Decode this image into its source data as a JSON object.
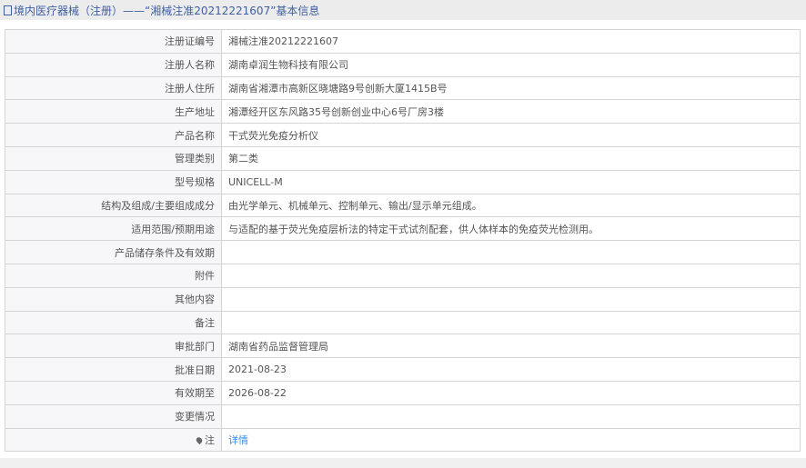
{
  "title": "境内医疗器械（注册）——“湘械注准20212221607”基本信息",
  "rows": [
    {
      "label": "注册证编号",
      "value": "湘械注准20212221607"
    },
    {
      "label": "注册人名称",
      "value": "湖南卓润生物科技有限公司"
    },
    {
      "label": "注册人住所",
      "value": "湖南省湘潭市高新区晓塘路9号创新大厦1415B号"
    },
    {
      "label": "生产地址",
      "value": "湘潭经开区东风路35号创新创业中心6号厂房3楼"
    },
    {
      "label": "产品名称",
      "value": "干式荧光免疫分析仪"
    },
    {
      "label": "管理类别",
      "value": "第二类"
    },
    {
      "label": "型号规格",
      "value": "UNICELL-M"
    },
    {
      "label": "结构及组成/主要组成成分",
      "value": "由光学单元、机械单元、控制单元、输出/显示单元组成。"
    },
    {
      "label": "适用范围/预期用途",
      "value": "与适配的基于荧光免疫层析法的特定干式试剂配套，供人体样本的免疫荧光检测用。"
    },
    {
      "label": "产品储存条件及有效期",
      "value": ""
    },
    {
      "label": "附件",
      "value": ""
    },
    {
      "label": "其他内容",
      "value": ""
    },
    {
      "label": "备注",
      "value": ""
    },
    {
      "label": "审批部门",
      "value": "湖南省药品监督管理局"
    },
    {
      "label": "批准日期",
      "value": "2021-08-23"
    },
    {
      "label": "有效期至",
      "value": "2026-08-22"
    },
    {
      "label": "变更情况",
      "value": ""
    }
  ],
  "note": {
    "label": "注",
    "link": "详情"
  }
}
